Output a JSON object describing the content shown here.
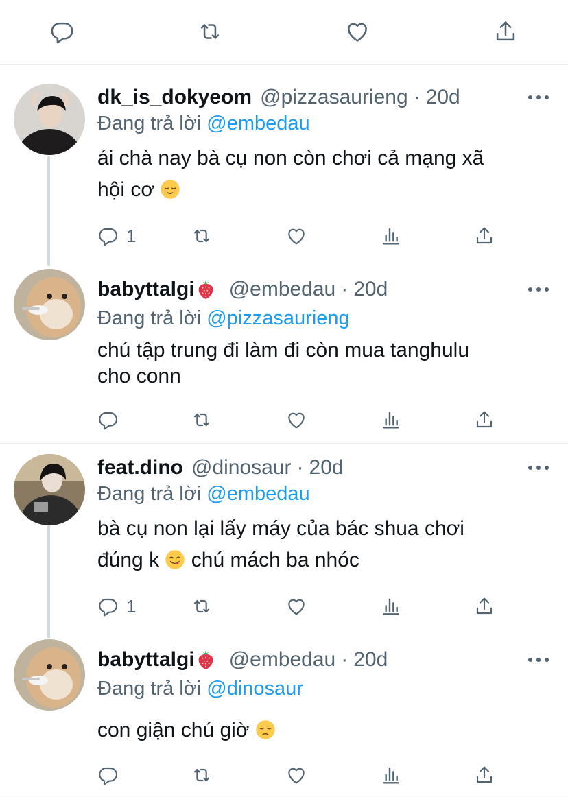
{
  "top_actions": {
    "icons": [
      "reply-icon",
      "retweet-icon",
      "like-icon",
      "share-icon"
    ]
  },
  "tweets": [
    {
      "display_name": "dk_is_dokyeom",
      "has_strawberry": false,
      "handle": "@pizzasaurieng",
      "separator": "·",
      "time": "20d",
      "reply_prefix": "Đang trả lời",
      "reply_mention": "@embedau",
      "text_line1": "ái chà nay bà cụ non còn chơi cả mạng xã",
      "text_line2": "hội cơ",
      "text_emoji": "relieved-face-emoji",
      "reply_count": "1"
    },
    {
      "display_name": "babyttalgi",
      "has_strawberry": true,
      "handle": "@embedau",
      "separator": "·",
      "time": "20d",
      "reply_prefix": "Đang trả lời",
      "reply_mention": "@pizzasaurieng",
      "text_line1": "chú tập trung đi làm đi còn mua tanghulu",
      "text_line2": "cho conn",
      "text_emoji": "",
      "reply_count": ""
    },
    {
      "display_name": "feat.dino",
      "has_strawberry": false,
      "handle": "@dinosaur",
      "separator": "·",
      "time": "20d",
      "reply_prefix": "Đang trả lời",
      "reply_mention": "@embedau",
      "text_line1": "bà cụ non lại lấy máy của bác shua chơi",
      "text_line2_pre": "đúng k",
      "text_line2_post": "chú mách ba nhóc",
      "text_emoji": "yum-face-emoji",
      "reply_count": "1"
    },
    {
      "display_name": "babyttalgi",
      "has_strawberry": true,
      "handle": "@embedau",
      "separator": "·",
      "time": "20d",
      "reply_prefix": "Đang trả lời",
      "reply_mention": "@dinosaur",
      "text_line1": "con giận chú giờ",
      "text_emoji": "disappointed-face-emoji",
      "reply_count": ""
    }
  ],
  "colors": {
    "text": "#0f1419",
    "secondary": "#536471",
    "link": "#1d9bf0",
    "divider": "#e6ecf0",
    "thread_line": "#cfd9de"
  }
}
